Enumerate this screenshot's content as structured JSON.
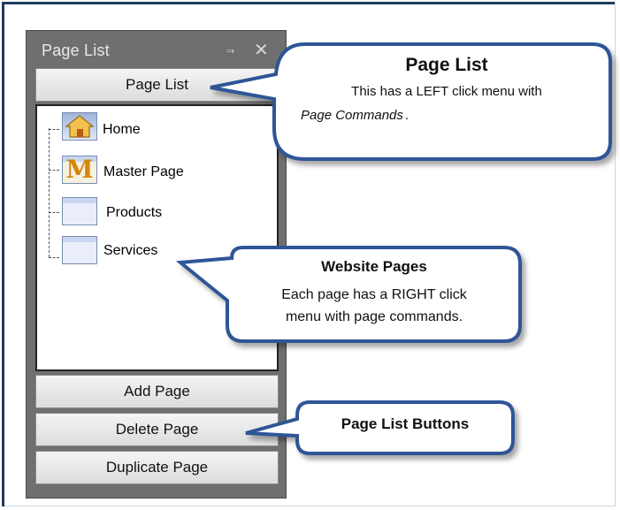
{
  "panel": {
    "title": "Page List",
    "pin_icon": "pin-icon",
    "close_icon": "close-icon",
    "top_button": "Page List"
  },
  "pages": [
    {
      "label": "Home",
      "icon": "home-icon"
    },
    {
      "label": "Master Page",
      "icon": "master-page-icon"
    },
    {
      "label": "Products",
      "icon": "page-icon"
    },
    {
      "label": "Services",
      "icon": "page-icon"
    }
  ],
  "buttons": {
    "add": "Add Page",
    "delete": "Delete Page",
    "duplicate": "Duplicate Page"
  },
  "callouts": {
    "page_list": {
      "title": "Page List",
      "line1": "This has a LEFT click menu with",
      "line2": "Page Commands",
      "line2_suffix": "."
    },
    "website_pages": {
      "title": "Website Pages",
      "line1": "Each page has a  RIGHT click",
      "line2": "menu  with page commands."
    },
    "buttons": {
      "title": "Page List Buttons"
    }
  },
  "colors": {
    "frame": "#1f3b5c",
    "callout_border": "#2d5596",
    "panel_bg": "#6f6f6f"
  }
}
